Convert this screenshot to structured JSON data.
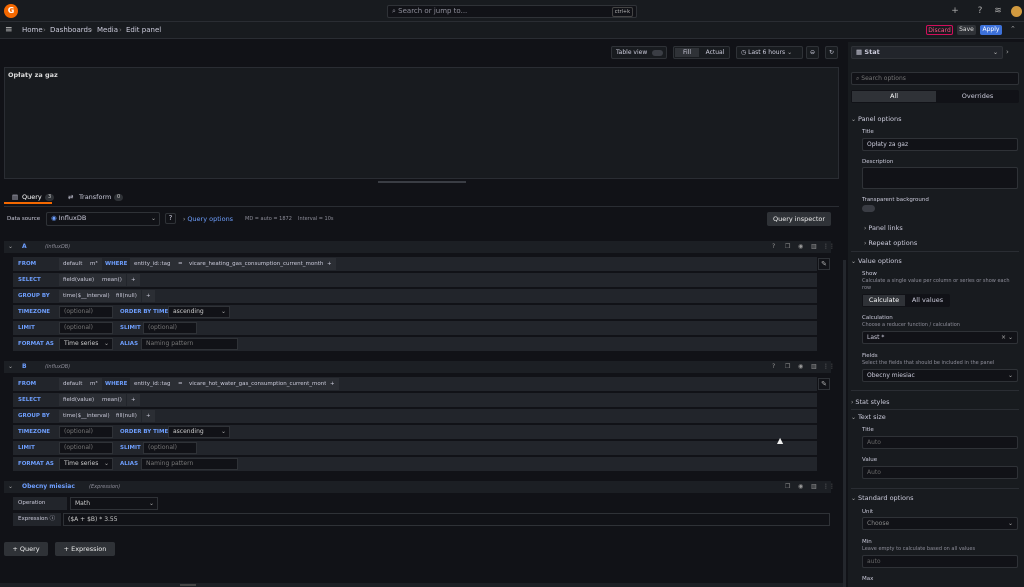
{
  "topbar": {
    "logo": "G",
    "search_placeholder": "Search or jump to...",
    "search_shortcut": "ctrl+k",
    "icons": [
      "plus-icon",
      "help-icon",
      "rss-icon",
      "user-avatar"
    ]
  },
  "breadcrumb": {
    "items": [
      "Home",
      "Dashboards",
      "Media",
      "Edit panel"
    ],
    "separator": "›",
    "discard": "Discard",
    "save": "Save",
    "apply": "Apply"
  },
  "toolbar": {
    "table_view": "Table view",
    "fill": "Fill",
    "actual": "Actual",
    "time_range": "Last 6 hours"
  },
  "panel": {
    "title": "Opłaty za gaz"
  },
  "tabs": [
    {
      "label": "Query",
      "count": "3"
    },
    {
      "label": "Transform",
      "count": "0"
    }
  ],
  "datasource": {
    "label": "Data source",
    "value": "InfluxDB",
    "query_options": "Query options",
    "meta1": "MD = auto = 1872",
    "meta2": "Interval = 10s",
    "inspector": "Query inspector"
  },
  "queries": [
    {
      "ref": "A",
      "type": "(InfluxDB)",
      "from": [
        "default",
        "m³"
      ],
      "where_kw": "WHERE",
      "where": [
        "entity_id::tag",
        "=",
        "vicare_heating_gas_consumption_current_month"
      ],
      "select": [
        "field(value)",
        "mean()"
      ],
      "group_by": [
        "time($__interval)",
        "fill(null)"
      ],
      "timezone_ph": "(optional)",
      "order_kw": "ORDER BY TIME",
      "order": "ascending",
      "limit_ph": "(optional)",
      "slimit_kw": "SLIMIT",
      "slimit_ph": "(optional)",
      "format": "Time series",
      "alias_kw": "ALIAS",
      "alias_ph": "Naming pattern"
    },
    {
      "ref": "B",
      "type": "(InfluxDB)",
      "from": [
        "default",
        "m³"
      ],
      "where_kw": "WHERE",
      "where": [
        "entity_id::tag",
        "=",
        "vicare_hot_water_gas_consumption_current_month"
      ],
      "select": [
        "field(value)",
        "mean()"
      ],
      "group_by": [
        "time($__interval)",
        "fill(null)"
      ],
      "timezone_ph": "(optional)",
      "order_kw": "ORDER BY TIME",
      "order": "ascending",
      "limit_ph": "(optional)",
      "slimit_kw": "SLIMIT",
      "slimit_ph": "(optional)",
      "format": "Time series",
      "alias_kw": "ALIAS",
      "alias_ph": "Naming pattern"
    }
  ],
  "row_labels": {
    "from": "FROM",
    "select": "SELECT",
    "group_by": "GROUP BY",
    "timezone": "TIMEZONE",
    "limit": "LIMIT",
    "format": "FORMAT AS"
  },
  "expression": {
    "name": "Obecny miesiac",
    "type": "(Expression)",
    "operation_label": "Operation",
    "operation": "Math",
    "expression_label": "Expression",
    "expression": "($A + $B) * 3.55"
  },
  "add": {
    "query": "+ Query",
    "expression": "+ Expression"
  },
  "sidebar": {
    "viz": "Stat",
    "search_placeholder": "Search options",
    "tab_all": "All",
    "tab_overrides": "Overrides",
    "panel_options": "Panel options",
    "title_label": "Title",
    "title_value": "Opłaty za gaz",
    "description_label": "Description",
    "transparent_label": "Transparent background",
    "panel_links": "Panel links",
    "repeat_options": "Repeat options",
    "value_options": "Value options",
    "show_label": "Show",
    "show_desc": "Calculate a single value per column or series or show each row",
    "calculate": "Calculate",
    "all_values": "All values",
    "calculation_label": "Calculation",
    "calculation_desc": "Choose a reducer function / calculation",
    "calculation_value": "Last *",
    "fields_label": "Fields",
    "fields_desc": "Select the fields that should be included in the panel",
    "fields_value": "Obecny miesiac",
    "stat_styles": "Stat styles",
    "text_size": "Text size",
    "ts_title": "Title",
    "ts_title_ph": "Auto",
    "ts_value": "Value",
    "ts_value_ph": "Auto",
    "standard_options": "Standard options",
    "unit_label": "Unit",
    "unit_ph": "Choose",
    "min_label": "Min",
    "min_desc": "Leave empty to calculate based on all values",
    "min_ph": "auto",
    "max_label": "Max"
  }
}
